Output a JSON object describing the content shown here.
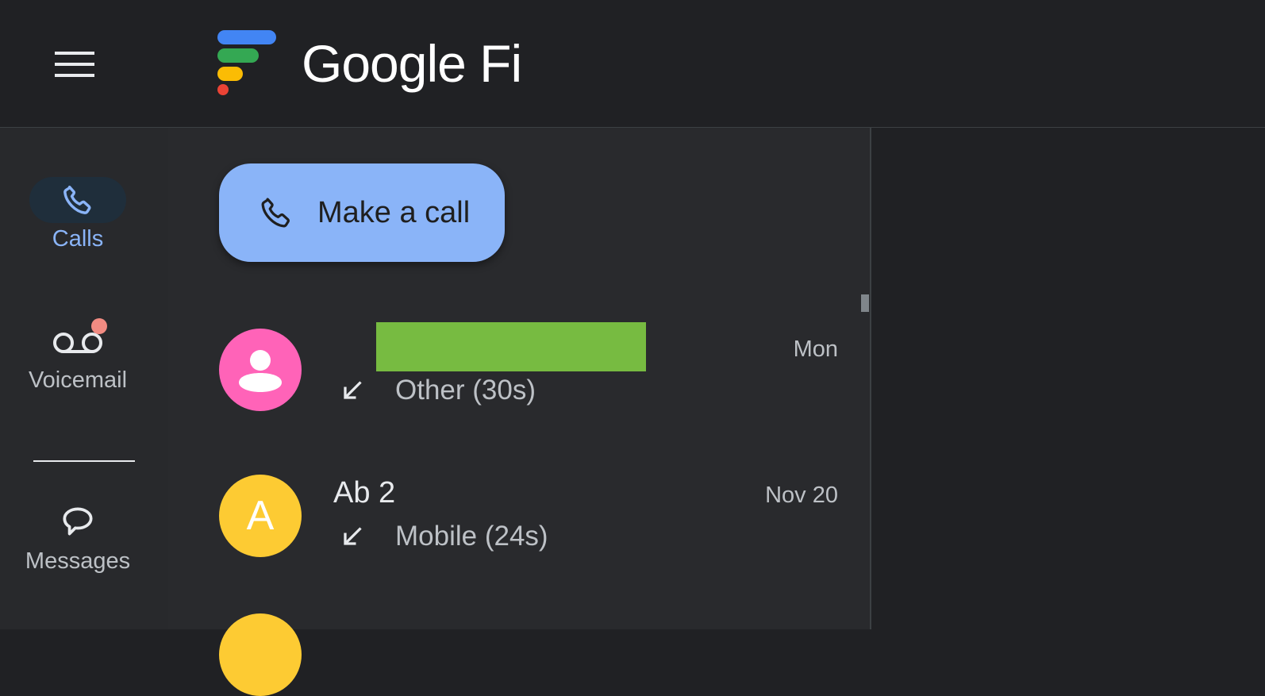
{
  "app": {
    "title": "Google Fi"
  },
  "topbar": {
    "menu_icon": "hamburger-menu-icon"
  },
  "rail": {
    "items": [
      {
        "label": "Calls",
        "icon": "phone-icon",
        "active": true
      },
      {
        "label": "Voicemail",
        "icon": "voicemail-icon",
        "active": false,
        "has_badge": true
      },
      {
        "label": "Messages",
        "icon": "chat-bubble-icon",
        "active": false
      }
    ]
  },
  "main": {
    "make_call_label": "Make a call",
    "calls": [
      {
        "name": "",
        "name_redacted": true,
        "avatar_letter": "",
        "avatar_color": "#ff63b8",
        "direction_icon": "incoming-call-arrow-icon",
        "detail": "Other (30s)",
        "date": "Mon"
      },
      {
        "name": "Ab 2",
        "name_redacted": false,
        "avatar_letter": "A",
        "avatar_color": "#fdcb33",
        "direction_icon": "incoming-call-arrow-icon",
        "detail": "Mobile (24s)",
        "date": "Nov 20"
      }
    ]
  },
  "colors": {
    "accent": "#8ab4f8",
    "background": "#202124",
    "panel": "#292a2d",
    "rail": "#28292c",
    "badge": "#f28b82"
  }
}
